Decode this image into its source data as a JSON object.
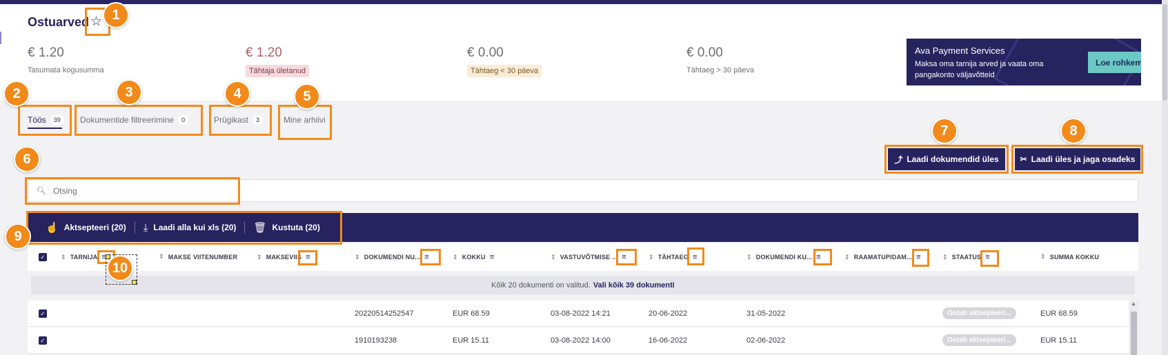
{
  "page": {
    "title": "Ostuarved"
  },
  "summary": [
    {
      "value": "€ 1.20",
      "label": "Tasumata kogusumma"
    },
    {
      "value": "€ 1.20",
      "label": "Tähtaja ületanud"
    },
    {
      "value": "€ 0.00",
      "label": "Tähtaeg < 30 päeva"
    },
    {
      "value": "€ 0.00",
      "label": "Tähtaeg > 30 päeva"
    }
  ],
  "promo": {
    "title": "Ava Payment Services",
    "text": "Maksa oma tarnija arved ja vaata oma pangakonto väljavõtteid",
    "button": "Loe rohkem"
  },
  "tabs": [
    {
      "label": "Töös",
      "count": "39"
    },
    {
      "label": "Dokumentide filtreerimine",
      "count": "0"
    },
    {
      "label": "Prügikast",
      "count": "3"
    },
    {
      "label": "Mine arhiivi"
    }
  ],
  "buttons": {
    "upload": "Laadi dokumendid üles",
    "upload_split": "Laadi üles ja jaga osadeks"
  },
  "search": {
    "placeholder": "Otsing"
  },
  "actions": [
    {
      "label": "Aktsepteeri (20)"
    },
    {
      "label": "Laadi alla kui xls (20)"
    },
    {
      "label": "Kustuta (20)"
    }
  ],
  "table": {
    "columns": [
      "TARNIJA",
      "MAKSE VIITENUMBER",
      "MAKSEVIIS",
      "DOKUMENDI NU...",
      "KOKKU",
      "VASTUVÕTMISE ...",
      "TÄHTAEG",
      "DOKUMENDI KU...",
      "RAAMATUPIDAM...",
      "STAATUS",
      "SUMMA KOKKU"
    ],
    "selection_notice": "Kõik 20 dokumenti on valitud.",
    "select_all_link": "Vali kõik 39 dokumenti",
    "rows": [
      {
        "doc_number": "20220514252547",
        "total": "EUR 68.59",
        "received": "03-08-2022 14:21",
        "due": "20-06-2022",
        "doc_date": "31-05-2022",
        "status": "Ootab aktsepteeri...",
        "sum_total": "EUR 68.59"
      },
      {
        "doc_number": "1910193238",
        "total": "EUR 15.11",
        "received": "03-08-2022 14:00",
        "due": "16-06-2022",
        "doc_date": "02-06-2022",
        "status": "Ootab aktsepteeri...",
        "sum_total": "EUR 15.11"
      }
    ]
  },
  "annotations": [
    "1",
    "2",
    "3",
    "4",
    "5",
    "6",
    "7",
    "8",
    "9",
    "10"
  ],
  "colors": {
    "brand": "#27235e",
    "accent": "#6cc8c4",
    "annotation": "#f28a1a"
  }
}
